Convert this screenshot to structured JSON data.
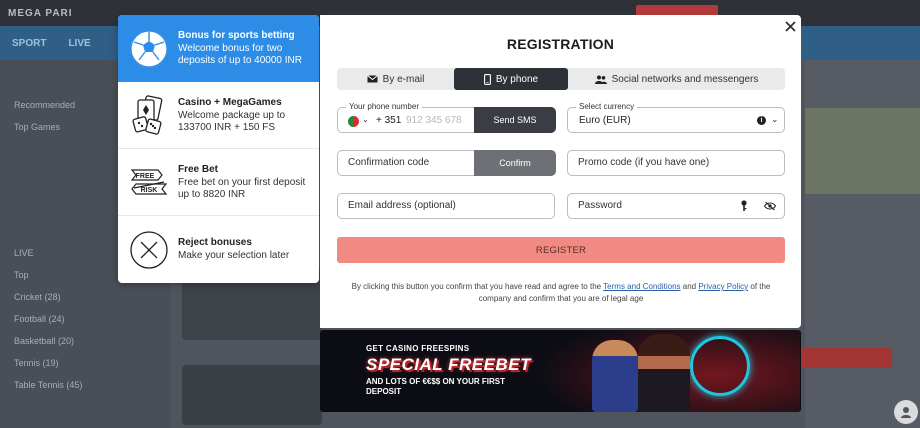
{
  "background": {
    "logo": "MEGA PARI",
    "nav": [
      "SPORT",
      "LIVE"
    ],
    "sidebar_items": [
      "Recommended",
      "Top Games",
      "LIVE",
      "Top",
      "Cricket (28)",
      "Football (24)",
      "Basketball (20)",
      "Tennis (19)",
      "Table Tennis (45)"
    ]
  },
  "bonus_panel": {
    "items": [
      {
        "title": "Bonus for sports betting",
        "desc": "Welcome bonus for two deposits of up to 40000 INR",
        "icon": "soccer-ball-icon",
        "active": true
      },
      {
        "title": "Casino + MegaGames",
        "desc": "Welcome package up to 133700 INR + 150 FS",
        "icon": "dice-cards-icon",
        "active": false
      },
      {
        "title": "Free Bet",
        "desc": "Free bet on your first deposit up to 8820 INR",
        "icon": "free-risk-ticket-icon",
        "free_label": "FREE",
        "risk_label": "RISK",
        "active": false
      },
      {
        "title": "Reject bonuses",
        "desc": "Make your selection later",
        "icon": "reject-x-icon",
        "active": false
      }
    ]
  },
  "modal": {
    "title": "REGISTRATION",
    "close_symbol": "✕",
    "tabs": [
      {
        "label": "By e-mail",
        "icon": "email-icon"
      },
      {
        "label": "By phone",
        "icon": "phone-icon",
        "active": true
      },
      {
        "label": "Social networks and messengers",
        "icon": "social-icon"
      }
    ],
    "phone": {
      "label": "Your phone number",
      "country_code": "+ 351",
      "placeholder": "912 345 678",
      "send_sms_label": "Send SMS",
      "chevron": "⌄"
    },
    "currency": {
      "label": "Select currency",
      "value": "Euro (EUR)",
      "info": "i",
      "chevron": "⌄"
    },
    "confirmation": {
      "placeholder": "Confirmation code",
      "button_label": "Confirm"
    },
    "promo": {
      "placeholder": "Promo code (if you have one)"
    },
    "email": {
      "placeholder": "Email address (optional)"
    },
    "password": {
      "placeholder": "Password"
    },
    "register_label": "REGISTER",
    "disclaimer": {
      "before": "By clicking this button you confirm that you have read and agree to the ",
      "terms": "Terms and Conditions",
      "and": " and ",
      "privacy": "Privacy Policy",
      "after": " of the company and confirm that you are of legal age"
    }
  },
  "banner": {
    "small": "GET CASINO FREESPINS",
    "big": "SPECIAL FREEBET",
    "sub": "AND LOTS OF €€$$ ON YOUR FIRST DEPOSIT"
  },
  "colors": {
    "accent_blue": "#2c8ce6",
    "register_pink": "#f08a83",
    "dark_button": "#3a3e44",
    "link": "#2a5fa8"
  }
}
